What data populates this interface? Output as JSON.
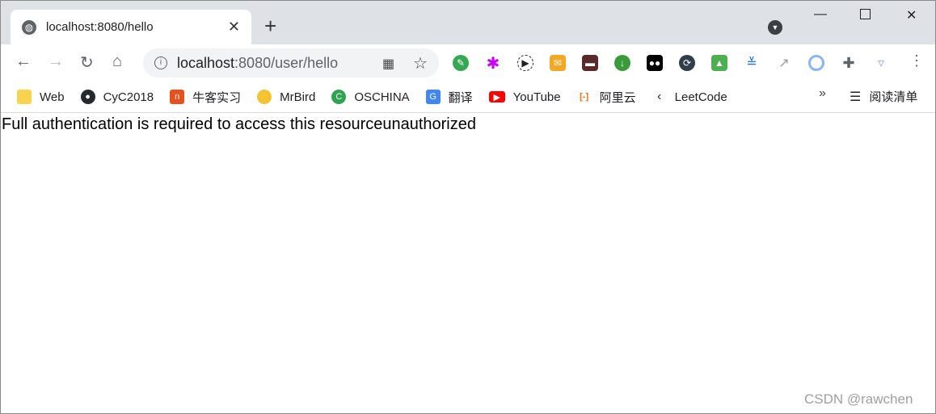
{
  "tab": {
    "title": "localhost:8080/hello",
    "favicon": "globe-icon"
  },
  "toolbar": {
    "url_host": "localhost",
    "url_path": ":8080/user/hello"
  },
  "extensions": [
    "chrome-icon",
    "pinwheel-icon",
    "play-icon",
    "ticket-icon",
    "mask-icon",
    "idm-icon",
    "tampermonkey-icon",
    "sync-icon",
    "evernote-icon",
    "download-icon",
    "trend-icon",
    "ring-icon",
    "puzzle-icon",
    "cup-icon"
  ],
  "bookmarks": [
    {
      "label": "Web",
      "icon": "folder-icon",
      "color": "#f9d24e"
    },
    {
      "label": "CyC2018",
      "icon": "github-icon",
      "color": "#24292e"
    },
    {
      "label": "牛客实习",
      "icon": "nowcoder-icon",
      "color": "#e8501d"
    },
    {
      "label": "MrBird",
      "icon": "bird-icon",
      "color": "#f4c430"
    },
    {
      "label": "OSCHINA",
      "icon": "oschina-icon",
      "color": "#2ea44f"
    },
    {
      "label": "翻译",
      "icon": "google-translate-icon",
      "color": "#4285f4"
    },
    {
      "label": "YouTube",
      "icon": "youtube-icon",
      "color": "#ff0000"
    },
    {
      "label": "阿里云",
      "icon": "aliyun-icon",
      "color": "#ff6a00"
    },
    {
      "label": "LeetCode",
      "icon": "leetcode-icon",
      "color": "#333333"
    }
  ],
  "reading_list": "阅读清单",
  "content": {
    "message": "Full authentication is required to access this resourceunauthorized"
  },
  "watermark": "CSDN @rawchen"
}
